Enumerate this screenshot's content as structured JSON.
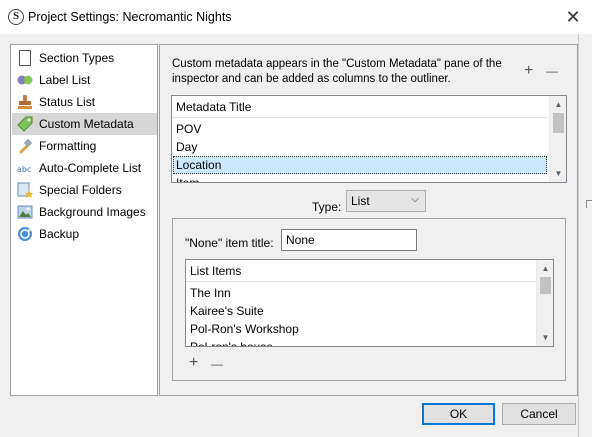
{
  "window": {
    "app_icon_letter": "S",
    "title": "Project Settings: Necromantic Nights",
    "close_glyph": "✕"
  },
  "sidebar": {
    "items": [
      {
        "label": "Section Types",
        "icon": "section-types-icon",
        "selected": false
      },
      {
        "label": "Label List",
        "icon": "label-list-icon",
        "selected": false
      },
      {
        "label": "Status List",
        "icon": "status-list-icon",
        "selected": false
      },
      {
        "label": "Custom Metadata",
        "icon": "custom-metadata-icon",
        "selected": true
      },
      {
        "label": "Formatting",
        "icon": "formatting-icon",
        "selected": false
      },
      {
        "label": "Auto-Complete List",
        "icon": "auto-complete-icon",
        "selected": false
      },
      {
        "label": "Special Folders",
        "icon": "special-folders-icon",
        "selected": false
      },
      {
        "label": "Background Images",
        "icon": "background-images-icon",
        "selected": false
      },
      {
        "label": "Backup",
        "icon": "backup-icon",
        "selected": false
      }
    ]
  },
  "metadata": {
    "description": "Custom metadata appears in the \"Custom Metadata\" pane of the inspector and can be added as columns to the outliner.",
    "add_glyph": "+",
    "remove_glyph": "—",
    "column_header": "Metadata Title",
    "rows": [
      "POV",
      "Day",
      "Location",
      "Item"
    ],
    "selected_row": "Location"
  },
  "type_field": {
    "label": "Type:",
    "value": "List"
  },
  "list_settings": {
    "none_title_label": "\"None\" item title:",
    "none_title_value": "None",
    "column_header": "List Items",
    "rows": [
      "The Inn",
      "Kairee's Suite",
      "Pol-Ron's Workshop",
      "Pol-ron's house"
    ],
    "add_glyph": "+",
    "remove_glyph": "—"
  },
  "buttons": {
    "ok": "OK",
    "cancel": "Cancel"
  },
  "colors": {
    "selection_highlight": "#cce8ff",
    "default_button_border": "#0078d7",
    "sidebar_selected": "#d6d6d6"
  }
}
